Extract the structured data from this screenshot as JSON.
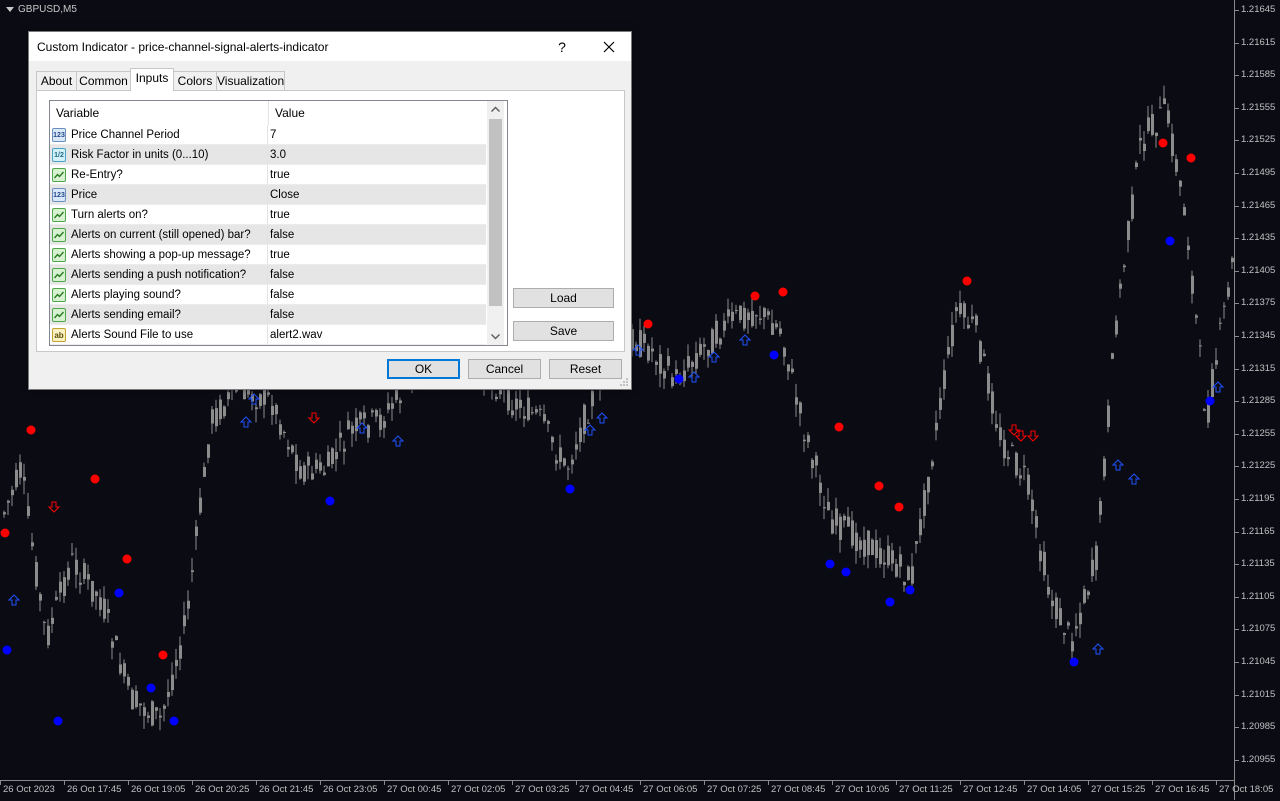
{
  "chart": {
    "symbol": "GBPUSD,M5",
    "price_labels": [
      "1.21645",
      "1.21615",
      "1.21585",
      "1.21555",
      "1.21525",
      "1.21495",
      "1.21465",
      "1.21435",
      "1.21405",
      "1.21375",
      "1.21345",
      "1.21315",
      "1.21285",
      "1.21255",
      "1.21225",
      "1.21195",
      "1.21165",
      "1.21135",
      "1.21105",
      "1.21075",
      "1.21045",
      "1.21015",
      "1.20985",
      "1.20955"
    ],
    "time_labels": [
      "26 Oct 2023",
      "26 Oct 17:45",
      "26 Oct 19:05",
      "26 Oct 20:25",
      "26 Oct 21:45",
      "26 Oct 23:05",
      "27 Oct 00:45",
      "27 Oct 02:05",
      "27 Oct 03:25",
      "27 Oct 04:45",
      "27 Oct 06:05",
      "27 Oct 07:25",
      "27 Oct 08:45",
      "27 Oct 10:05",
      "27 Oct 11:25",
      "27 Oct 12:45",
      "27 Oct 14:05",
      "27 Oct 15:25",
      "27 Oct 16:45",
      "27 Oct 18:05"
    ],
    "colors": {
      "background": "#0b0b14",
      "candles": "#8c8c8c",
      "sell_dot": "#ff0000",
      "buy_dot": "#0000ff",
      "sell_arrow": "#ff0000",
      "buy_arrow": "#1f52ff"
    }
  },
  "dialog": {
    "title": "Custom Indicator - price-channel-signal-alerts-indicator",
    "help_label": "?",
    "tabs": [
      {
        "label": "About"
      },
      {
        "label": "Common"
      },
      {
        "label": "Inputs"
      },
      {
        "label": "Colors"
      },
      {
        "label": "Visualization"
      }
    ],
    "active_tab": "Inputs",
    "grid": {
      "col_variable": "Variable",
      "col_value": "Value",
      "rows": [
        {
          "type": "int-icon",
          "icon": "123",
          "variable": "Price Channel Period",
          "value": "7"
        },
        {
          "type": "double-icon",
          "icon": "1/2",
          "variable": "Risk Factor in units (0...10)",
          "value": "3.0"
        },
        {
          "type": "bool-icon",
          "icon": "",
          "variable": "Re-Entry?",
          "value": "true"
        },
        {
          "type": "int-icon",
          "icon": "123",
          "variable": "Price",
          "value": "Close"
        },
        {
          "type": "bool-icon",
          "icon": "",
          "variable": "Turn alerts on?",
          "value": "true"
        },
        {
          "type": "bool-icon",
          "icon": "",
          "variable": "Alerts on current (still opened) bar?",
          "value": "false"
        },
        {
          "type": "bool-icon",
          "icon": "",
          "variable": "Alerts showing a pop-up message?",
          "value": "true"
        },
        {
          "type": "bool-icon",
          "icon": "",
          "variable": "Alerts sending a push notification?",
          "value": "false"
        },
        {
          "type": "bool-icon",
          "icon": "",
          "variable": "Alerts playing sound?",
          "value": "false"
        },
        {
          "type": "bool-icon",
          "icon": "",
          "variable": "Alerts sending email?",
          "value": "false"
        },
        {
          "type": "string-icon",
          "icon": "ab",
          "variable": "Alerts Sound File to use",
          "value": "alert2.wav"
        }
      ]
    },
    "load_label": "Load",
    "save_label": "Save",
    "ok_label": "OK",
    "cancel_label": "Cancel",
    "reset_label": "Reset"
  }
}
